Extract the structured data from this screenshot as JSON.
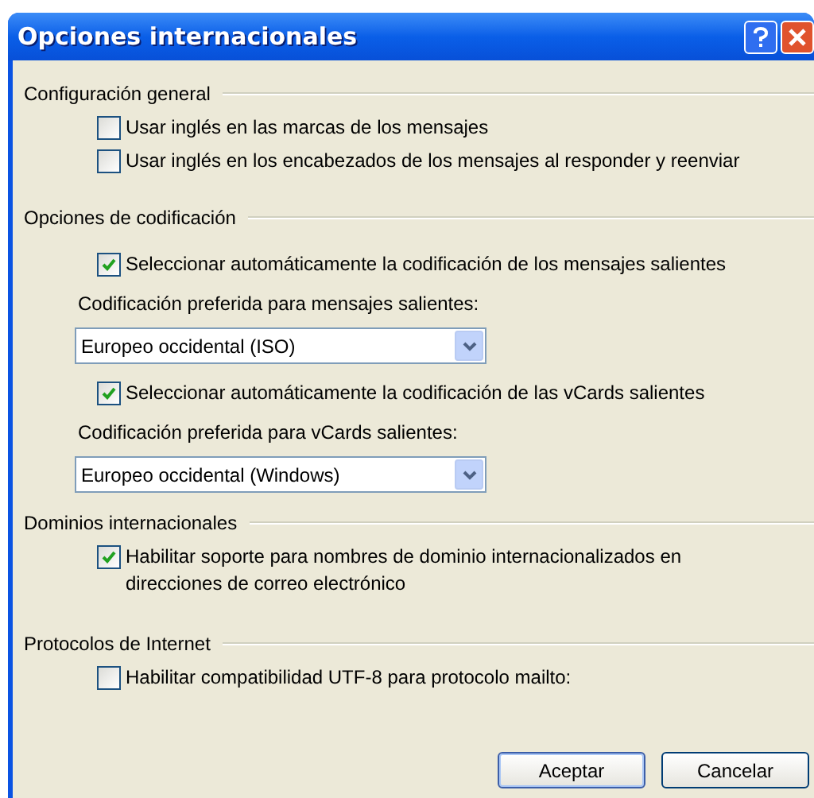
{
  "window": {
    "title": "Opciones internacionales"
  },
  "sections": [
    {
      "title": "Configuración general",
      "items": [
        {
          "kind": "checkbox",
          "label": "Usar inglés en las marcas de los mensajes",
          "checked": false
        },
        {
          "kind": "checkbox",
          "label": "Usar inglés en los encabezados de los mensajes al responder y reenviar",
          "checked": false
        }
      ]
    },
    {
      "title": "Opciones de codificación",
      "items": [
        {
          "kind": "checkbox",
          "label": "Seleccionar automáticamente la codificación de los mensajes salientes",
          "checked": true
        },
        {
          "kind": "label",
          "label": "Codificación preferida para mensajes salientes:"
        },
        {
          "kind": "dropdown",
          "value": "Europeo occidental (ISO)"
        },
        {
          "kind": "checkbox",
          "label": "Seleccionar automáticamente la codificación de las vCards salientes",
          "checked": true
        },
        {
          "kind": "label",
          "label": "Codificación preferida para vCards salientes:"
        },
        {
          "kind": "dropdown",
          "value": "Europeo occidental (Windows)"
        }
      ]
    },
    {
      "title": "Dominios internacionales",
      "items": [
        {
          "kind": "checkbox",
          "label": "Habilitar soporte para nombres de dominio internacionalizados en direcciones de correo electrónico",
          "checked": true
        }
      ]
    },
    {
      "title": "Protocolos de Internet",
      "items": [
        {
          "kind": "checkbox",
          "label": "Habilitar compatibilidad UTF-8 para protocolo mailto:",
          "checked": false
        }
      ]
    }
  ],
  "buttons": [
    "Aceptar",
    "Cancelar"
  ]
}
